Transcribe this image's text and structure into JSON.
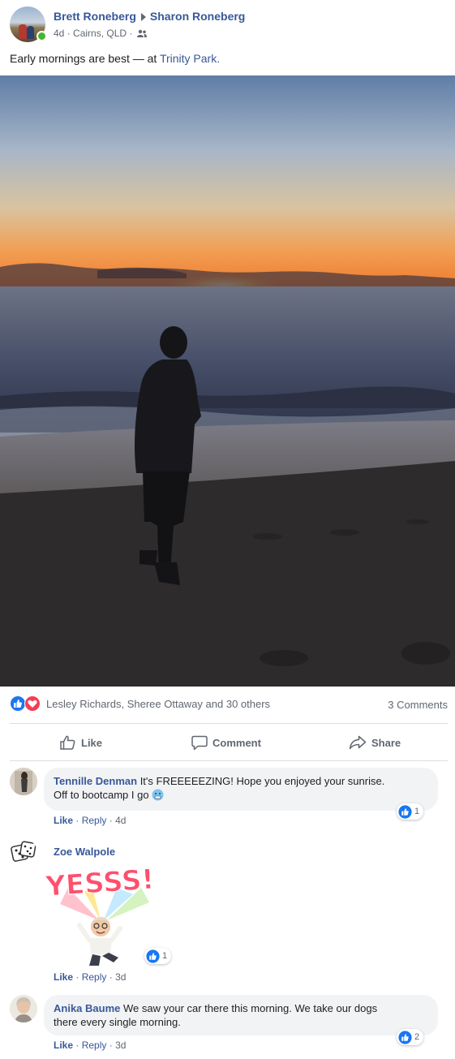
{
  "post": {
    "author": "Brett Roneberg",
    "tagged": "Sharon Roneberg",
    "time": "4d",
    "location": "Cairns, QLD",
    "audience_icon": "friends-icon",
    "text": "Early mornings are best — at ",
    "place": "Trinity Park.",
    "photo_icon": "sunrise-beach-photo"
  },
  "reactions": {
    "icons": [
      "like-icon",
      "love-icon"
    ],
    "summary": "Lesley Richards, Sheree Ottaway and 30 others",
    "comments_count": "3 Comments"
  },
  "actions": {
    "like": "Like",
    "comment": "Comment",
    "share": "Share"
  },
  "comments": [
    {
      "name": "Tennille Denman",
      "text_line1": "It's FREEEEEZING! Hope you enjoyed your sunrise.",
      "text_line2": "Off to bootcamp I go",
      "emoji_icon": "cold-face-icon",
      "like_label": "Like",
      "reply_label": "Reply",
      "time": "4d",
      "reaction_count": "1"
    },
    {
      "name": "Zoe Walpole",
      "sticker_text": "YESSS!",
      "sticker_icon": "avatar-sticker",
      "like_label": "Like",
      "reply_label": "Reply",
      "time": "3d",
      "reaction_count": "1"
    },
    {
      "name": "Anika Baume",
      "text_line1": "We saw your car there this morning. We take our dogs",
      "text_line2": "there every single morning.",
      "like_label": "Like",
      "reply_label": "Reply",
      "time": "3d",
      "reaction_count": "2"
    }
  ],
  "colors": {
    "link": "#385898",
    "meta": "#606770",
    "bubble": "#f2f3f5",
    "like_blue": "#1877f2",
    "love_red": "#f33e58",
    "online": "#42b72a"
  }
}
